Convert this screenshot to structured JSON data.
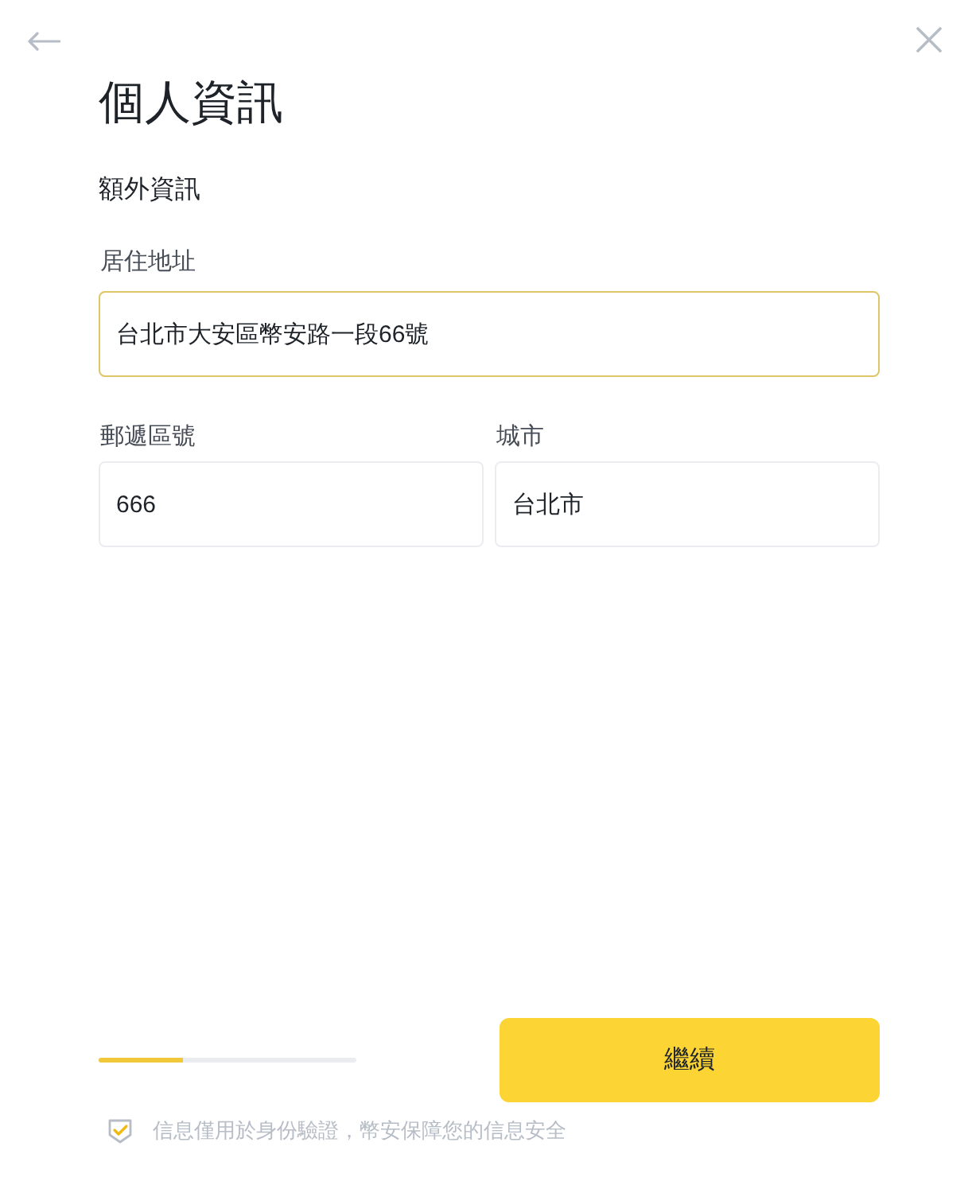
{
  "title": "個人資訊",
  "subtitle": "額外資訊",
  "field_rows": [
    [
      {
        "label": "居住地址",
        "value": "台北市大安區幣安路一段66號",
        "focused": true
      }
    ],
    [
      {
        "label": "郵遞區號",
        "value": "666",
        "focused": false
      },
      {
        "label": "城市",
        "value": "台北市",
        "focused": false
      }
    ]
  ],
  "progress": {
    "level": 0.33
  },
  "continue_button": {
    "label": "繼續"
  },
  "notice": {
    "text": "信息僅用於身份驗證，幣安保障您的信息安全"
  }
}
